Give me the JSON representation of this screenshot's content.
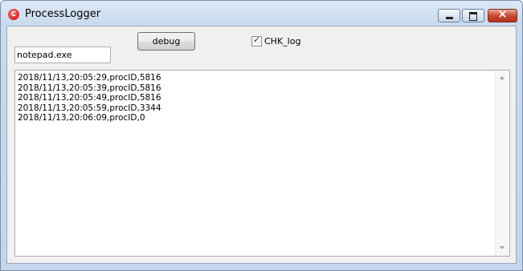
{
  "window": {
    "title": "ProcessLogger",
    "icon": "app-icon",
    "controls": {
      "minimize_icon": "minimize-icon",
      "maximize_icon": "maximize-icon",
      "close_glyph": "×"
    }
  },
  "toolbar": {
    "debug_label": "debug",
    "checkbox_label": "CHK_log",
    "checkbox_checked": true,
    "checkbox_mark": "✓"
  },
  "process_input": {
    "value": "notepad.exe"
  },
  "log": {
    "lines": [
      "2018/11/13,20:05:29,procID,5816",
      "2018/11/13,20:05:39,procID,5816",
      "2018/11/13,20:05:49,procID,5816",
      "2018/11/13,20:05:59,procID,3344",
      "2018/11/13,20:06:09,procID,0"
    ]
  },
  "colors": {
    "close_button": "#c74a33",
    "title_gradient_top": "#dce8f5",
    "client_bg": "#f0f0f0"
  }
}
